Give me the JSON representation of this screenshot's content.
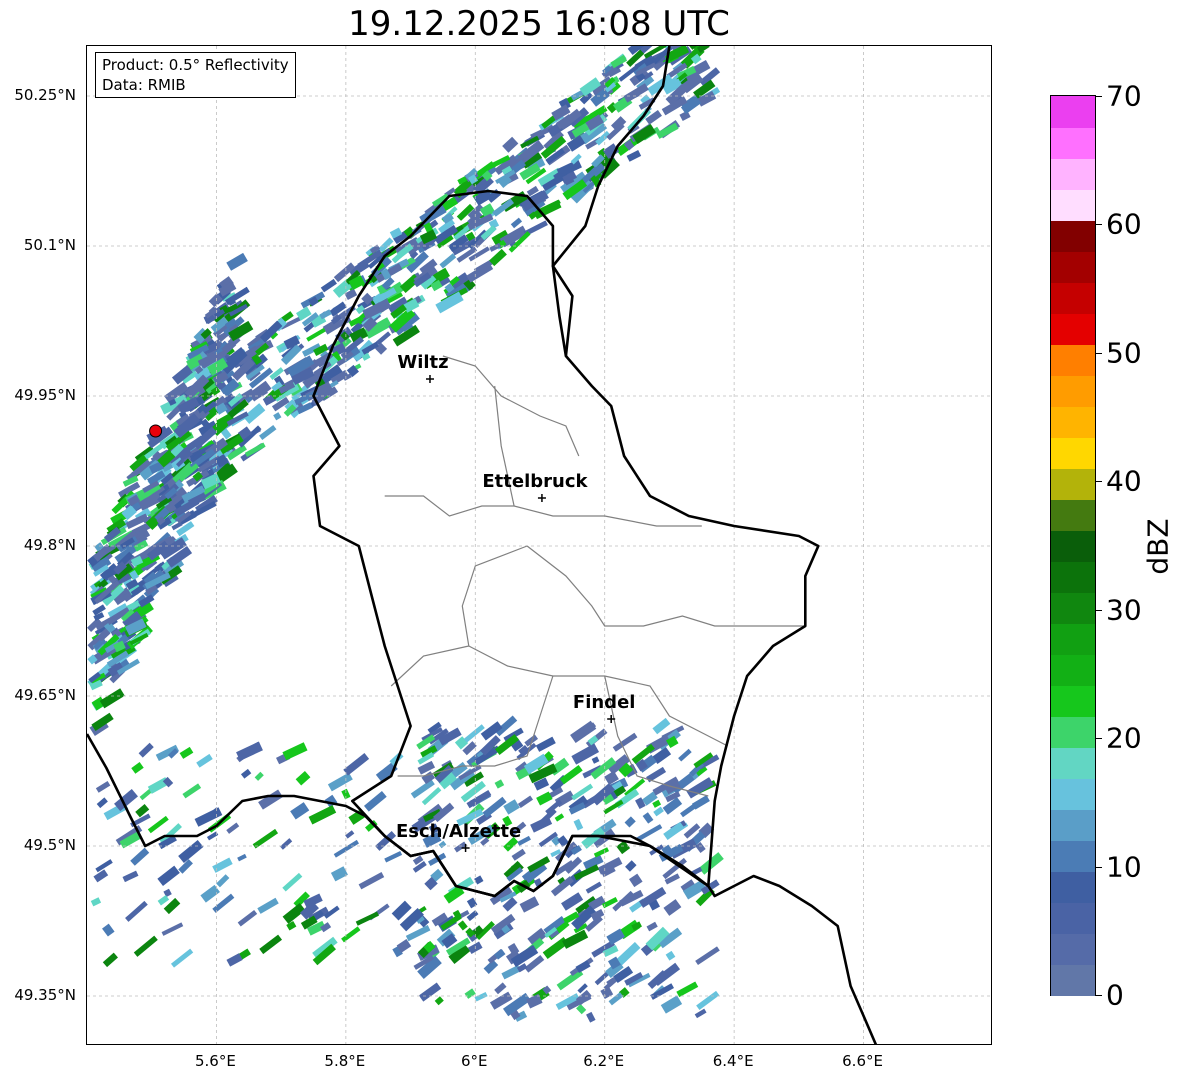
{
  "title": "19.12.2025 16:08 UTC",
  "info_box": {
    "product": "Product: 0.5° Reflectivity",
    "data": "Data: RMIB"
  },
  "map": {
    "lon_range": [
      5.4,
      6.8
    ],
    "lat_range": [
      49.3,
      50.3
    ],
    "lat_ticks": [
      {
        "value": 49.35,
        "label": "49.35°N"
      },
      {
        "value": 49.5,
        "label": "49.5°N"
      },
      {
        "value": 49.65,
        "label": "49.65°N"
      },
      {
        "value": 49.8,
        "label": "49.8°N"
      },
      {
        "value": 49.95,
        "label": "49.95°N"
      },
      {
        "value": 50.1,
        "label": "50.1°N"
      },
      {
        "value": 50.25,
        "label": "50.25°N"
      }
    ],
    "lon_ticks": [
      {
        "value": 5.6,
        "label": "5.6°E"
      },
      {
        "value": 5.8,
        "label": "5.8°E"
      },
      {
        "value": 6.0,
        "label": "6°E"
      },
      {
        "value": 6.2,
        "label": "6.2°E"
      },
      {
        "value": 6.4,
        "label": "6.4°E"
      },
      {
        "value": 6.6,
        "label": "6.6°E"
      }
    ],
    "cities": [
      {
        "name": "Wiltz",
        "lon": 5.93,
        "lat": 49.967
      },
      {
        "name": "Ettelbruck",
        "lon": 6.103,
        "lat": 49.848
      },
      {
        "name": "Findel",
        "lon": 6.21,
        "lat": 49.627
      },
      {
        "name": "Esch/Alzette",
        "lon": 5.985,
        "lat": 49.498
      }
    ],
    "radar_site": {
      "lon": 5.506,
      "lat": 49.915,
      "color": "#e8000b"
    },
    "country_border": [
      [
        5.4,
        49.612
      ],
      [
        5.43,
        49.578
      ],
      [
        5.468,
        49.528
      ],
      [
        5.49,
        49.5
      ],
      [
        5.52,
        49.51
      ],
      [
        5.57,
        49.51
      ],
      [
        5.6,
        49.52
      ],
      [
        5.64,
        49.545
      ],
      [
        5.68,
        49.55
      ],
      [
        5.72,
        49.55
      ],
      [
        5.76,
        49.545
      ],
      [
        5.8,
        49.54
      ],
      [
        5.83,
        49.53
      ],
      [
        5.86,
        49.51
      ],
      [
        5.9,
        49.49
      ],
      [
        5.935,
        49.495
      ],
      [
        5.97,
        49.46
      ],
      [
        6.0,
        49.455
      ],
      [
        6.03,
        49.45
      ],
      [
        6.06,
        49.465
      ],
      [
        6.09,
        49.455
      ],
      [
        6.12,
        49.47
      ],
      [
        6.15,
        49.51
      ],
      [
        6.19,
        49.51
      ],
      [
        6.24,
        49.51
      ],
      [
        6.27,
        49.5
      ],
      [
        6.32,
        49.48
      ],
      [
        6.36,
        49.46
      ],
      [
        6.37,
        49.45
      ],
      [
        6.4,
        49.46
      ],
      [
        6.43,
        49.47
      ],
      [
        6.47,
        49.46
      ],
      [
        6.52,
        49.44
      ],
      [
        6.56,
        49.42
      ],
      [
        6.58,
        49.36
      ],
      [
        6.6,
        49.33
      ],
      [
        6.62,
        49.3
      ]
    ],
    "lux_border": [
      [
        5.81,
        49.545
      ],
      [
        5.87,
        49.57
      ],
      [
        5.9,
        49.62
      ],
      [
        5.86,
        49.7
      ],
      [
        5.84,
        49.75
      ],
      [
        5.82,
        49.8
      ],
      [
        5.76,
        49.82
      ],
      [
        5.75,
        49.87
      ],
      [
        5.79,
        49.9
      ],
      [
        5.75,
        49.95
      ],
      [
        5.78,
        50.0
      ],
      [
        5.82,
        50.05
      ],
      [
        5.86,
        50.09
      ],
      [
        5.9,
        50.11
      ],
      [
        5.96,
        50.15
      ],
      [
        6.02,
        50.155
      ],
      [
        6.08,
        50.15
      ],
      [
        6.12,
        50.12
      ],
      [
        6.12,
        50.08
      ],
      [
        6.13,
        50.03
      ],
      [
        6.14,
        49.99
      ],
      [
        6.18,
        49.96
      ],
      [
        6.21,
        49.94
      ],
      [
        6.23,
        49.89
      ],
      [
        6.27,
        49.85
      ],
      [
        6.33,
        49.83
      ],
      [
        6.4,
        49.82
      ],
      [
        6.5,
        49.81
      ],
      [
        6.53,
        49.8
      ],
      [
        6.51,
        49.77
      ],
      [
        6.51,
        49.72
      ],
      [
        6.46,
        49.7
      ],
      [
        6.42,
        49.67
      ],
      [
        6.4,
        49.63
      ],
      [
        6.38,
        49.58
      ],
      [
        6.37,
        49.545
      ],
      [
        6.36,
        49.46
      ],
      [
        6.27,
        49.5
      ],
      [
        6.19,
        49.51
      ],
      [
        6.15,
        49.51
      ],
      [
        6.12,
        49.47
      ],
      [
        6.09,
        49.455
      ],
      [
        6.06,
        49.465
      ],
      [
        6.03,
        49.45
      ],
      [
        6.0,
        49.455
      ],
      [
        5.97,
        49.46
      ],
      [
        5.935,
        49.495
      ],
      [
        5.9,
        49.49
      ],
      [
        5.86,
        49.51
      ],
      [
        5.81,
        49.545
      ]
    ],
    "de_border_north": [
      [
        6.14,
        49.99
      ],
      [
        6.15,
        50.05
      ],
      [
        6.12,
        50.08
      ],
      [
        6.17,
        50.12
      ],
      [
        6.19,
        50.16
      ],
      [
        6.22,
        50.2
      ],
      [
        6.26,
        50.23
      ],
      [
        6.29,
        50.26
      ],
      [
        6.3,
        50.3
      ]
    ],
    "cantons": [
      [
        [
          5.95,
          49.99
        ],
        [
          6.0,
          49.98
        ],
        [
          6.04,
          49.95
        ],
        [
          6.1,
          49.93
        ],
        [
          6.14,
          49.92
        ],
        [
          6.16,
          49.89
        ]
      ],
      [
        [
          5.86,
          49.85
        ],
        [
          5.92,
          49.85
        ],
        [
          5.96,
          49.83
        ],
        [
          6.01,
          49.84
        ],
        [
          6.06,
          49.84
        ],
        [
          6.12,
          49.83
        ],
        [
          6.2,
          49.83
        ],
        [
          6.28,
          49.82
        ],
        [
          6.35,
          49.82
        ]
      ],
      [
        [
          6.03,
          49.96
        ],
        [
          6.04,
          49.9
        ],
        [
          6.06,
          49.84
        ]
      ],
      [
        [
          6.08,
          49.8
        ],
        [
          6.0,
          49.78
        ],
        [
          5.98,
          49.74
        ],
        [
          5.99,
          49.7
        ],
        [
          5.92,
          49.69
        ],
        [
          5.87,
          49.66
        ]
      ],
      [
        [
          6.08,
          49.8
        ],
        [
          6.14,
          49.77
        ],
        [
          6.18,
          49.74
        ],
        [
          6.2,
          49.72
        ],
        [
          6.26,
          49.72
        ],
        [
          6.32,
          49.73
        ],
        [
          6.37,
          49.72
        ],
        [
          6.44,
          49.72
        ],
        [
          6.51,
          49.72
        ]
      ],
      [
        [
          5.99,
          49.7
        ],
        [
          6.05,
          49.68
        ],
        [
          6.12,
          49.67
        ],
        [
          6.2,
          49.67
        ],
        [
          6.27,
          49.66
        ],
        [
          6.3,
          49.63
        ],
        [
          6.36,
          49.61
        ],
        [
          6.39,
          49.6
        ]
      ],
      [
        [
          6.12,
          49.67
        ],
        [
          6.1,
          49.63
        ],
        [
          6.08,
          49.59
        ],
        [
          6.03,
          49.58
        ],
        [
          5.98,
          49.58
        ],
        [
          5.92,
          49.57
        ],
        [
          5.88,
          49.57
        ]
      ],
      [
        [
          6.2,
          49.67
        ],
        [
          6.22,
          49.61
        ],
        [
          6.25,
          49.57
        ],
        [
          6.3,
          49.56
        ],
        [
          6.36,
          49.55
        ]
      ]
    ],
    "echo_colors": [
      "#5b6fa8",
      "#4d66a6",
      "#3f5fa2",
      "#4b7bb5",
      "#5aa0c8",
      "#66c3dd",
      "#5fd6c5",
      "#3dd46a",
      "#16c71c",
      "#12a712",
      "#0b850f",
      "#f39700"
    ],
    "echo_regions": [
      {
        "lon": [
          5.55,
          6.35
        ],
        "lat": [
          49.9,
          50.3
        ],
        "axis": 0.55,
        "density": 0.55,
        "spread": 0.055
      },
      {
        "lon": [
          5.4,
          5.62
        ],
        "lat": [
          49.7,
          50.0
        ],
        "axis": 0.8,
        "density": 0.45,
        "spread": 0.09
      },
      {
        "lon": [
          5.9,
          6.35
        ],
        "lat": [
          49.33,
          49.62
        ],
        "axis": 0.0,
        "density": 0.35,
        "spread": 0.15
      },
      {
        "lon": [
          5.4,
          5.95
        ],
        "lat": [
          49.38,
          49.6
        ],
        "axis": 0.0,
        "density": 0.12,
        "spread": 0.2
      }
    ]
  },
  "colorbar": {
    "label": "dBZ",
    "min": 0,
    "max": 70,
    "ticks": [
      0,
      10,
      20,
      30,
      40,
      50,
      60,
      70
    ],
    "colors": [
      "#6177a8",
      "#556ba8",
      "#4a63a5",
      "#3f5fa2",
      "#4b7cb5",
      "#5a9ec8",
      "#67c2dd",
      "#62d6c3",
      "#3dd46a",
      "#16c71c",
      "#12b015",
      "#11a012",
      "#10870f",
      "#0c730b",
      "#0a5e0a",
      "#447a10",
      "#b3b30a",
      "#ffd700",
      "#ffb400",
      "#ff9c00",
      "#ff7f00",
      "#e40000",
      "#c50000",
      "#a30000",
      "#820000",
      "#ffddff",
      "#ffb3ff",
      "#ff70ff",
      "#eb3ff0"
    ]
  }
}
